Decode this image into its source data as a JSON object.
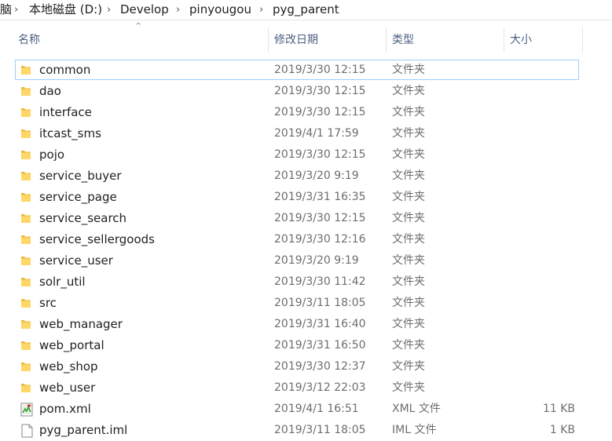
{
  "breadcrumb": {
    "items": [
      "脑",
      "本地磁盘 (D:)",
      "Develop",
      "pinyougou",
      "pyg_parent"
    ],
    "separator": "›"
  },
  "columns": {
    "name": "名称",
    "date": "修改日期",
    "type": "类型",
    "size": "大小"
  },
  "files": [
    {
      "name": "common",
      "date": "2019/3/30 12:15",
      "type": "文件夹",
      "size": "",
      "icon": "folder-icon",
      "selected": true
    },
    {
      "name": "dao",
      "date": "2019/3/30 12:15",
      "type": "文件夹",
      "size": "",
      "icon": "folder-icon"
    },
    {
      "name": "interface",
      "date": "2019/3/30 12:15",
      "type": "文件夹",
      "size": "",
      "icon": "folder-icon"
    },
    {
      "name": "itcast_sms",
      "date": "2019/4/1 17:59",
      "type": "文件夹",
      "size": "",
      "icon": "folder-icon"
    },
    {
      "name": "pojo",
      "date": "2019/3/30 12:15",
      "type": "文件夹",
      "size": "",
      "icon": "folder-icon"
    },
    {
      "name": "service_buyer",
      "date": "2019/3/20 9:19",
      "type": "文件夹",
      "size": "",
      "icon": "folder-icon"
    },
    {
      "name": "service_page",
      "date": "2019/3/31 16:35",
      "type": "文件夹",
      "size": "",
      "icon": "folder-icon"
    },
    {
      "name": "service_search",
      "date": "2019/3/30 12:15",
      "type": "文件夹",
      "size": "",
      "icon": "folder-icon"
    },
    {
      "name": "service_sellergoods",
      "date": "2019/3/30 12:16",
      "type": "文件夹",
      "size": "",
      "icon": "folder-icon"
    },
    {
      "name": "service_user",
      "date": "2019/3/20 9:19",
      "type": "文件夹",
      "size": "",
      "icon": "folder-icon"
    },
    {
      "name": "solr_util",
      "date": "2019/3/30 11:42",
      "type": "文件夹",
      "size": "",
      "icon": "folder-icon"
    },
    {
      "name": "src",
      "date": "2019/3/11 18:05",
      "type": "文件夹",
      "size": "",
      "icon": "folder-icon"
    },
    {
      "name": "web_manager",
      "date": "2019/3/31 16:40",
      "type": "文件夹",
      "size": "",
      "icon": "folder-icon"
    },
    {
      "name": "web_portal",
      "date": "2019/3/31 16:50",
      "type": "文件夹",
      "size": "",
      "icon": "folder-icon"
    },
    {
      "name": "web_shop",
      "date": "2019/3/30 12:37",
      "type": "文件夹",
      "size": "",
      "icon": "folder-icon"
    },
    {
      "name": "web_user",
      "date": "2019/3/12 22:03",
      "type": "文件夹",
      "size": "",
      "icon": "folder-icon"
    },
    {
      "name": "pom.xml",
      "date": "2019/4/1 16:51",
      "type": "XML 文件",
      "size": "11 KB",
      "icon": "xml-file-icon"
    },
    {
      "name": "pyg_parent.iml",
      "date": "2019/3/11 18:05",
      "type": "IML 文件",
      "size": "1 KB",
      "icon": "file-icon"
    }
  ],
  "colors": {
    "folder": "#ffd767",
    "folder_dark": "#e8b83a",
    "selection_border": "#99d1ff",
    "header_text": "#4d6082"
  }
}
